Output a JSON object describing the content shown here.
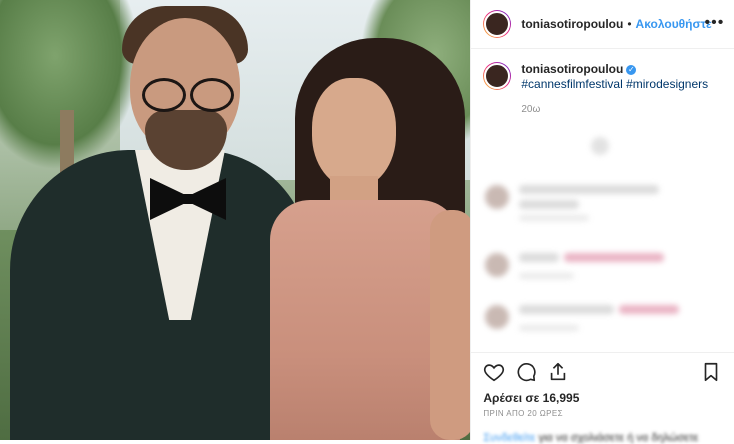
{
  "header": {
    "username": "toniasotiropoulou",
    "separator": "•",
    "follow_label": "Ακολουθήστε",
    "more_icon": "more-horizontal-icon",
    "more_label": "•••"
  },
  "caption": {
    "username": "toniasotiropoulou",
    "verified_icon": "verified-badge-icon",
    "verified_glyph": "✓",
    "hashtags": [
      "#cannesfilmfestival",
      "#mirodesigners"
    ],
    "time": "20ω"
  },
  "actions": {
    "like_icon": "heart-icon",
    "comment_icon": "comment-icon",
    "share_icon": "share-icon",
    "save_icon": "bookmark-icon",
    "likes_label": "Αρέσει σε 16,995",
    "timestamp": "ΠΡΙΝ ΑΠΟ 20 ΩΡΕΣ"
  },
  "login_prompt": {
    "link_text": "Συνδεθείτε",
    "rest_text": " για να σχολιάσετε ή να δηλώσετε"
  },
  "colors": {
    "accent": "#3897f0",
    "text": "#262626",
    "muted": "#8e8e8e",
    "hashtag": "#00376b"
  }
}
